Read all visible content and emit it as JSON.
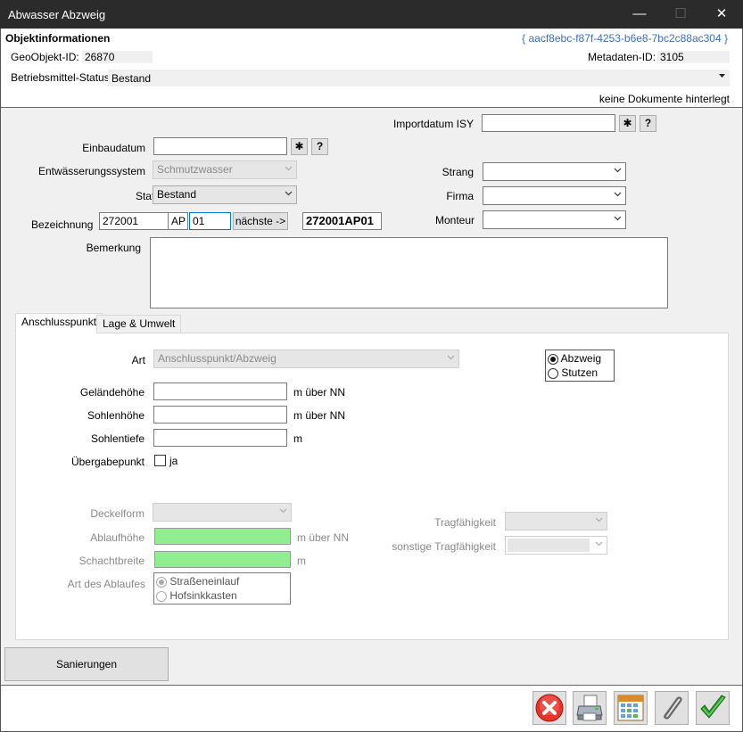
{
  "window": {
    "title": "Abwasser Abzweig",
    "minimize_glyph": "—",
    "maximize_glyph": "☐",
    "close_glyph": "✕"
  },
  "objektinformationen": {
    "heading": "Objektinformationen",
    "guid": "{ aacf8ebc-f87f-4253-b6e8-7bc2c88ac304 }",
    "geoobjekt_label": "GeoObjekt-ID:",
    "geoobjekt_value": "26870",
    "metadaten_label": "Metadaten-ID:",
    "metadaten_value": "3105",
    "betriebsmittel_label": "Betriebsmittel-Status:",
    "betriebsmittel_value": "Bestand",
    "dokumente_text": "keine Dokumente hinterlegt"
  },
  "form": {
    "importdatum_label": "Importdatum ISY",
    "importdatum_value": "",
    "star_btn": "✱",
    "help_btn": "?",
    "einbaudatum_label": "Einbaudatum",
    "einbaudatum_value": "",
    "entwaesserung_label": "Entwässerungssystem",
    "entwaesserung_value": "Schmutzwasser",
    "status_label": "Status",
    "status_value": "Bestand",
    "bezeichnung_label": "Bezeichnung",
    "bez_part1": "272001",
    "bez_part2": "AP",
    "bez_part3": "01",
    "naechste_btn": "nächste ->",
    "bez_result": "272001AP01",
    "strang_label": "Strang",
    "strang_value": "",
    "firma_label": "Firma",
    "firma_value": "",
    "monteur_label": "Monteur",
    "monteur_value": "",
    "bemerkung_label": "Bemerkung",
    "bemerkung_value": ""
  },
  "tabs": [
    {
      "label": "Anschlusspunkt"
    },
    {
      "label": "Lage & Umwelt"
    }
  ],
  "anschluss": {
    "art_label": "Art",
    "art_value": "Anschlusspunkt/Abzweig",
    "type_options": [
      {
        "label": "Abzweig",
        "checked": true
      },
      {
        "label": "Stutzen",
        "checked": false
      }
    ],
    "gelaendehoehe_label": "Geländehöhe",
    "gelaendehoehe_value": "",
    "sohlenhoehe_label": "Sohlenhöhe",
    "sohlenhoehe_value": "",
    "sohlentiefe_label": "Sohlentiefe",
    "sohlentiefe_value": "",
    "unit_nn": "m über NN",
    "unit_m": "m",
    "uebergabe_label": "Übergabepunkt",
    "uebergabe_checkbox_label": "ja",
    "deckelform_label": "Deckelform",
    "ablaufhoehe_label": "Ablaufhöhe",
    "schachtbreite_label": "Schachtbreite",
    "art_ablauf_label": "Art des Ablaufes",
    "ablauf_options": [
      {
        "label": "Straßeneinlauf",
        "checked": true
      },
      {
        "label": "Hofsinkkasten",
        "checked": false
      }
    ],
    "tragfaehigkeit_label": "Tragfähigkeit",
    "sonstige_label": "sonstige Tragfähigkeit"
  },
  "sanierungen_btn": "Sanierungen",
  "toolbar": {
    "icons": [
      "cancel-icon",
      "printer-icon",
      "calendar-icon",
      "paperclip-icon",
      "checkmark-icon"
    ],
    "colors": {
      "cancel": "#e8332a",
      "ok": "#2e9c2e",
      "green_field": "#90ee90",
      "guid": "#3a6fc4"
    }
  }
}
